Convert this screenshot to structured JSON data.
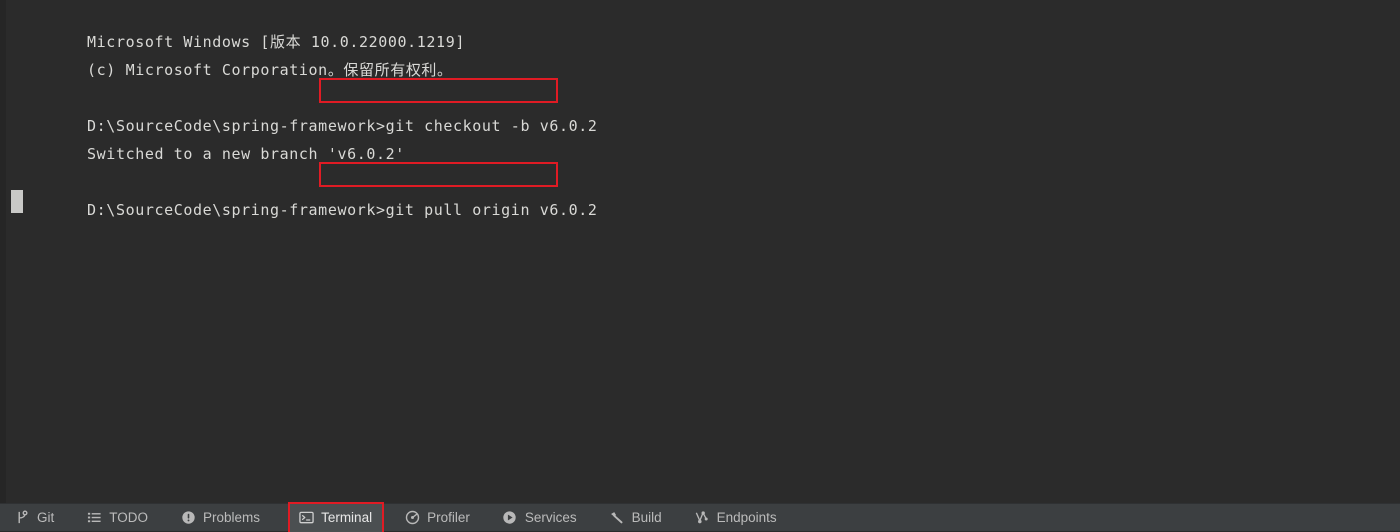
{
  "terminal": {
    "lines": [
      {
        "text": "Microsoft Windows [版本 10.0.22000.1219]",
        "blank": false
      },
      {
        "text": "(c) Microsoft Corporation。保留所有权利。",
        "blank": false
      },
      {
        "text": "",
        "blank": true
      },
      {
        "prompt": "D:\\SourceCode\\spring-framework>",
        "command": "git checkout -b v6.0.2",
        "blank": false
      },
      {
        "text": "Switched to a new branch 'v6.0.2'",
        "blank": false
      },
      {
        "text": "",
        "blank": true
      },
      {
        "prompt": "D:\\SourceCode\\spring-framework>",
        "command": "git pull origin v6.0.2",
        "blank": false
      }
    ],
    "line_0": "Microsoft Windows [版本 10.0.22000.1219]",
    "line_1": "(c) Microsoft Corporation。保留所有权利。",
    "line_2": "",
    "prompt_1": "D:\\SourceCode\\spring-framework>",
    "command_1": "git checkout -b v6.0.2",
    "line_4": "Switched to a new branch 'v6.0.2'",
    "line_5": "",
    "prompt_2": "D:\\SourceCode\\spring-framework>",
    "command_2": "git pull origin v6.0.2",
    "cursor": ""
  },
  "annotations": {
    "color": "#e01b24",
    "box_1_target": "git checkout -b v6.0.2",
    "box_2_target": "git pull origin v6.0.2",
    "box_3_target": "Terminal"
  },
  "bottom_bar": {
    "items": [
      {
        "label": "Git",
        "icon": "git-branch-icon",
        "active": false,
        "annotated": false
      },
      {
        "label": "TODO",
        "icon": "checklist-icon",
        "active": false,
        "annotated": false
      },
      {
        "label": "Problems",
        "icon": "exclamation-circle-icon",
        "active": false,
        "annotated": false
      },
      {
        "label": "Terminal",
        "icon": "terminal-prompt-icon",
        "active": true,
        "annotated": true
      },
      {
        "label": "Profiler",
        "icon": "profiler-gauge-icon",
        "active": false,
        "annotated": false
      },
      {
        "label": "Services",
        "icon": "play-circle-icon",
        "active": false,
        "annotated": false
      },
      {
        "label": "Build",
        "icon": "hammer-icon",
        "active": false,
        "annotated": false
      },
      {
        "label": "Endpoints",
        "icon": "endpoints-icon",
        "active": false,
        "annotated": false
      }
    ]
  },
  "colors": {
    "terminal_background": "#2b2b2b",
    "terminal_text": "#d9d9d6",
    "bar_background": "#3c3f41",
    "bar_text": "#bbbbbb",
    "annotation_red": "#e01b24",
    "cursor": "#c9c9c7"
  }
}
